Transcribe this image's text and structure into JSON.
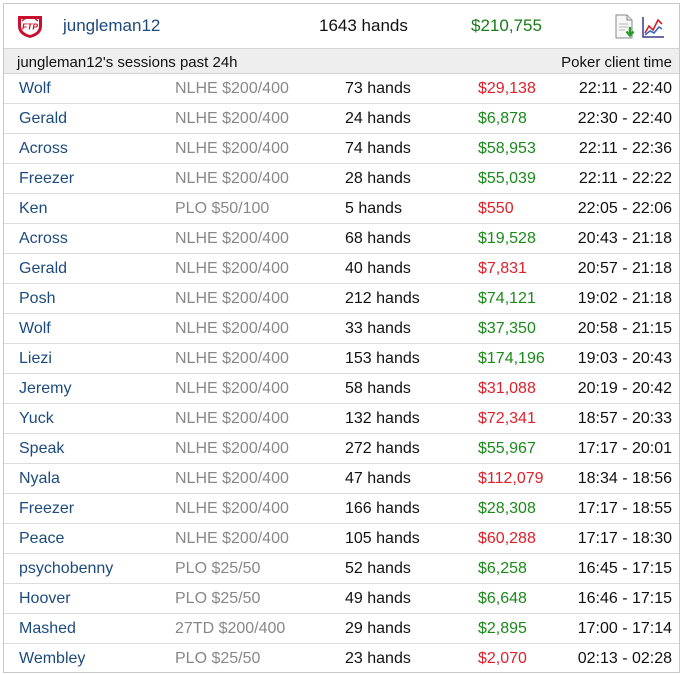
{
  "header": {
    "player_name": "jungleman12",
    "total_hands": "1643 hands",
    "total_amount": "$210,755",
    "logo_icon": "full-tilt-poker-logo-icon",
    "download_icon": "document-download-icon",
    "graph_icon": "line-graph-icon"
  },
  "subheader": {
    "title": "jungleman12's sessions past 24h",
    "time_label": "Poker client time"
  },
  "colors": {
    "positive": "#1a8a1a",
    "negative": "#e0202a",
    "player_link": "#1c4a7c",
    "game_text": "#888888"
  },
  "sessions": [
    {
      "player": "Wolf",
      "game": "NLHE $200/400",
      "hands": "73 hands",
      "amount": "$29,138",
      "result": "loss",
      "time": "22:11 - 22:40"
    },
    {
      "player": "Gerald",
      "game": "NLHE $200/400",
      "hands": "24 hands",
      "amount": "$6,878",
      "result": "win",
      "time": "22:30 - 22:40"
    },
    {
      "player": "Across",
      "game": "NLHE $200/400",
      "hands": "74 hands",
      "amount": "$58,953",
      "result": "win",
      "time": "22:11 - 22:36"
    },
    {
      "player": "Freezer",
      "game": "NLHE $200/400",
      "hands": "28 hands",
      "amount": "$55,039",
      "result": "win",
      "time": "22:11 - 22:22"
    },
    {
      "player": "Ken",
      "game": "PLO $50/100",
      "hands": "5 hands",
      "amount": "$550",
      "result": "loss",
      "time": "22:05 - 22:06"
    },
    {
      "player": "Across",
      "game": "NLHE $200/400",
      "hands": "68 hands",
      "amount": "$19,528",
      "result": "win",
      "time": "20:43 - 21:18"
    },
    {
      "player": "Gerald",
      "game": "NLHE $200/400",
      "hands": "40 hands",
      "amount": "$7,831",
      "result": "loss",
      "time": "20:57 - 21:18"
    },
    {
      "player": "Posh",
      "game": "NLHE $200/400",
      "hands": "212 hands",
      "amount": "$74,121",
      "result": "win",
      "time": "19:02 - 21:18"
    },
    {
      "player": "Wolf",
      "game": "NLHE $200/400",
      "hands": "33 hands",
      "amount": "$37,350",
      "result": "win",
      "time": "20:58 - 21:15"
    },
    {
      "player": "Liezi",
      "game": "NLHE $200/400",
      "hands": "153 hands",
      "amount": "$174,196",
      "result": "win",
      "time": "19:03 - 20:43"
    },
    {
      "player": "Jeremy",
      "game": "NLHE $200/400",
      "hands": "58 hands",
      "amount": "$31,088",
      "result": "loss",
      "time": "20:19 - 20:42"
    },
    {
      "player": "Yuck",
      "game": "NLHE $200/400",
      "hands": "132 hands",
      "amount": "$72,341",
      "result": "loss",
      "time": "18:57 - 20:33"
    },
    {
      "player": "Speak",
      "game": "NLHE $200/400",
      "hands": "272 hands",
      "amount": "$55,967",
      "result": "win",
      "time": "17:17 - 20:01"
    },
    {
      "player": "Nyala",
      "game": "NLHE $200/400",
      "hands": "47 hands",
      "amount": "$112,079",
      "result": "loss",
      "time": "18:34 - 18:56"
    },
    {
      "player": "Freezer",
      "game": "NLHE $200/400",
      "hands": "166 hands",
      "amount": "$28,308",
      "result": "win",
      "time": "17:17 - 18:55"
    },
    {
      "player": "Peace",
      "game": "NLHE $200/400",
      "hands": "105 hands",
      "amount": "$60,288",
      "result": "loss",
      "time": "17:17 - 18:30"
    },
    {
      "player": "psychobenny",
      "game": "PLO $25/50",
      "hands": "52 hands",
      "amount": "$6,258",
      "result": "win",
      "time": "16:45 - 17:15"
    },
    {
      "player": "Hoover",
      "game": "PLO $25/50",
      "hands": "49 hands",
      "amount": "$6,648",
      "result": "win",
      "time": "16:46 - 17:15"
    },
    {
      "player": "Mashed",
      "game": "27TD $200/400",
      "hands": "29 hands",
      "amount": "$2,895",
      "result": "win",
      "time": "17:00 - 17:14"
    },
    {
      "player": "Wembley",
      "game": "PLO $25/50",
      "hands": "23 hands",
      "amount": "$2,070",
      "result": "loss",
      "time": "02:13 - 02:28"
    }
  ]
}
